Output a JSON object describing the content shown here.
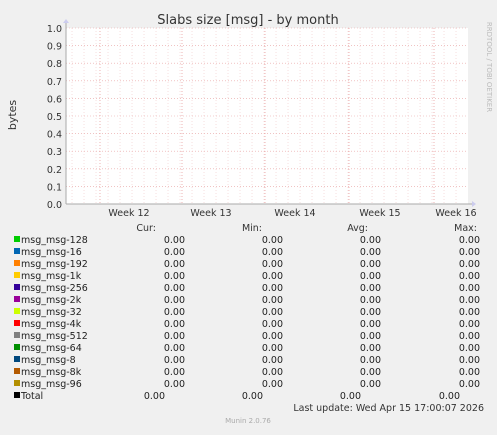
{
  "chart_data": {
    "type": "line",
    "title": "Slabs size [msg] - by month",
    "ylabel": "bytes",
    "xlabel": "",
    "ylim": [
      0,
      1
    ],
    "yticks": [
      "0.0",
      "0.1",
      "0.2",
      "0.3",
      "0.4",
      "0.5",
      "0.6",
      "0.7",
      "0.8",
      "0.9",
      "1.0"
    ],
    "x_ticks": [
      "Week 12",
      "Week 13",
      "Week 14",
      "Week 15",
      "Week 16"
    ],
    "grid": true,
    "series_values": "all 0.00",
    "legend_headers": [
      "Cur:",
      "Min:",
      "Avg:",
      "Max:"
    ],
    "series": [
      {
        "name": "msg_msg-128",
        "color": "#00cc00",
        "cur": "0.00",
        "min": "0.00",
        "avg": "0.00",
        "max": "0.00"
      },
      {
        "name": "msg_msg-16",
        "color": "#0066b3",
        "cur": "0.00",
        "min": "0.00",
        "avg": "0.00",
        "max": "0.00"
      },
      {
        "name": "msg_msg-192",
        "color": "#ff8000",
        "cur": "0.00",
        "min": "0.00",
        "avg": "0.00",
        "max": "0.00"
      },
      {
        "name": "msg_msg-1k",
        "color": "#ffcc00",
        "cur": "0.00",
        "min": "0.00",
        "avg": "0.00",
        "max": "0.00"
      },
      {
        "name": "msg_msg-256",
        "color": "#330099",
        "cur": "0.00",
        "min": "0.00",
        "avg": "0.00",
        "max": "0.00"
      },
      {
        "name": "msg_msg-2k",
        "color": "#990099",
        "cur": "0.00",
        "min": "0.00",
        "avg": "0.00",
        "max": "0.00"
      },
      {
        "name": "msg_msg-32",
        "color": "#ccff00",
        "cur": "0.00",
        "min": "0.00",
        "avg": "0.00",
        "max": "0.00"
      },
      {
        "name": "msg_msg-4k",
        "color": "#ff0000",
        "cur": "0.00",
        "min": "0.00",
        "avg": "0.00",
        "max": "0.00"
      },
      {
        "name": "msg_msg-512",
        "color": "#808080",
        "cur": "0.00",
        "min": "0.00",
        "avg": "0.00",
        "max": "0.00"
      },
      {
        "name": "msg_msg-64",
        "color": "#008f00",
        "cur": "0.00",
        "min": "0.00",
        "avg": "0.00",
        "max": "0.00"
      },
      {
        "name": "msg_msg-8",
        "color": "#00487d",
        "cur": "0.00",
        "min": "0.00",
        "avg": "0.00",
        "max": "0.00"
      },
      {
        "name": "msg_msg-8k",
        "color": "#b35a00",
        "cur": "0.00",
        "min": "0.00",
        "avg": "0.00",
        "max": "0.00"
      },
      {
        "name": "msg_msg-96",
        "color": "#b38f00",
        "cur": "0.00",
        "min": "0.00",
        "avg": "0.00",
        "max": "0.00"
      },
      {
        "name": "Total",
        "color": "#000000",
        "cur": "0.00",
        "min": "0.00",
        "avg": "0.00",
        "max": "0.00"
      }
    ],
    "side_label": "RRDTOOL / TOBI OETIKER",
    "last_update": "Last update: Wed Apr 15 17:00:07 2026",
    "footer": "Munin 2.0.76"
  }
}
